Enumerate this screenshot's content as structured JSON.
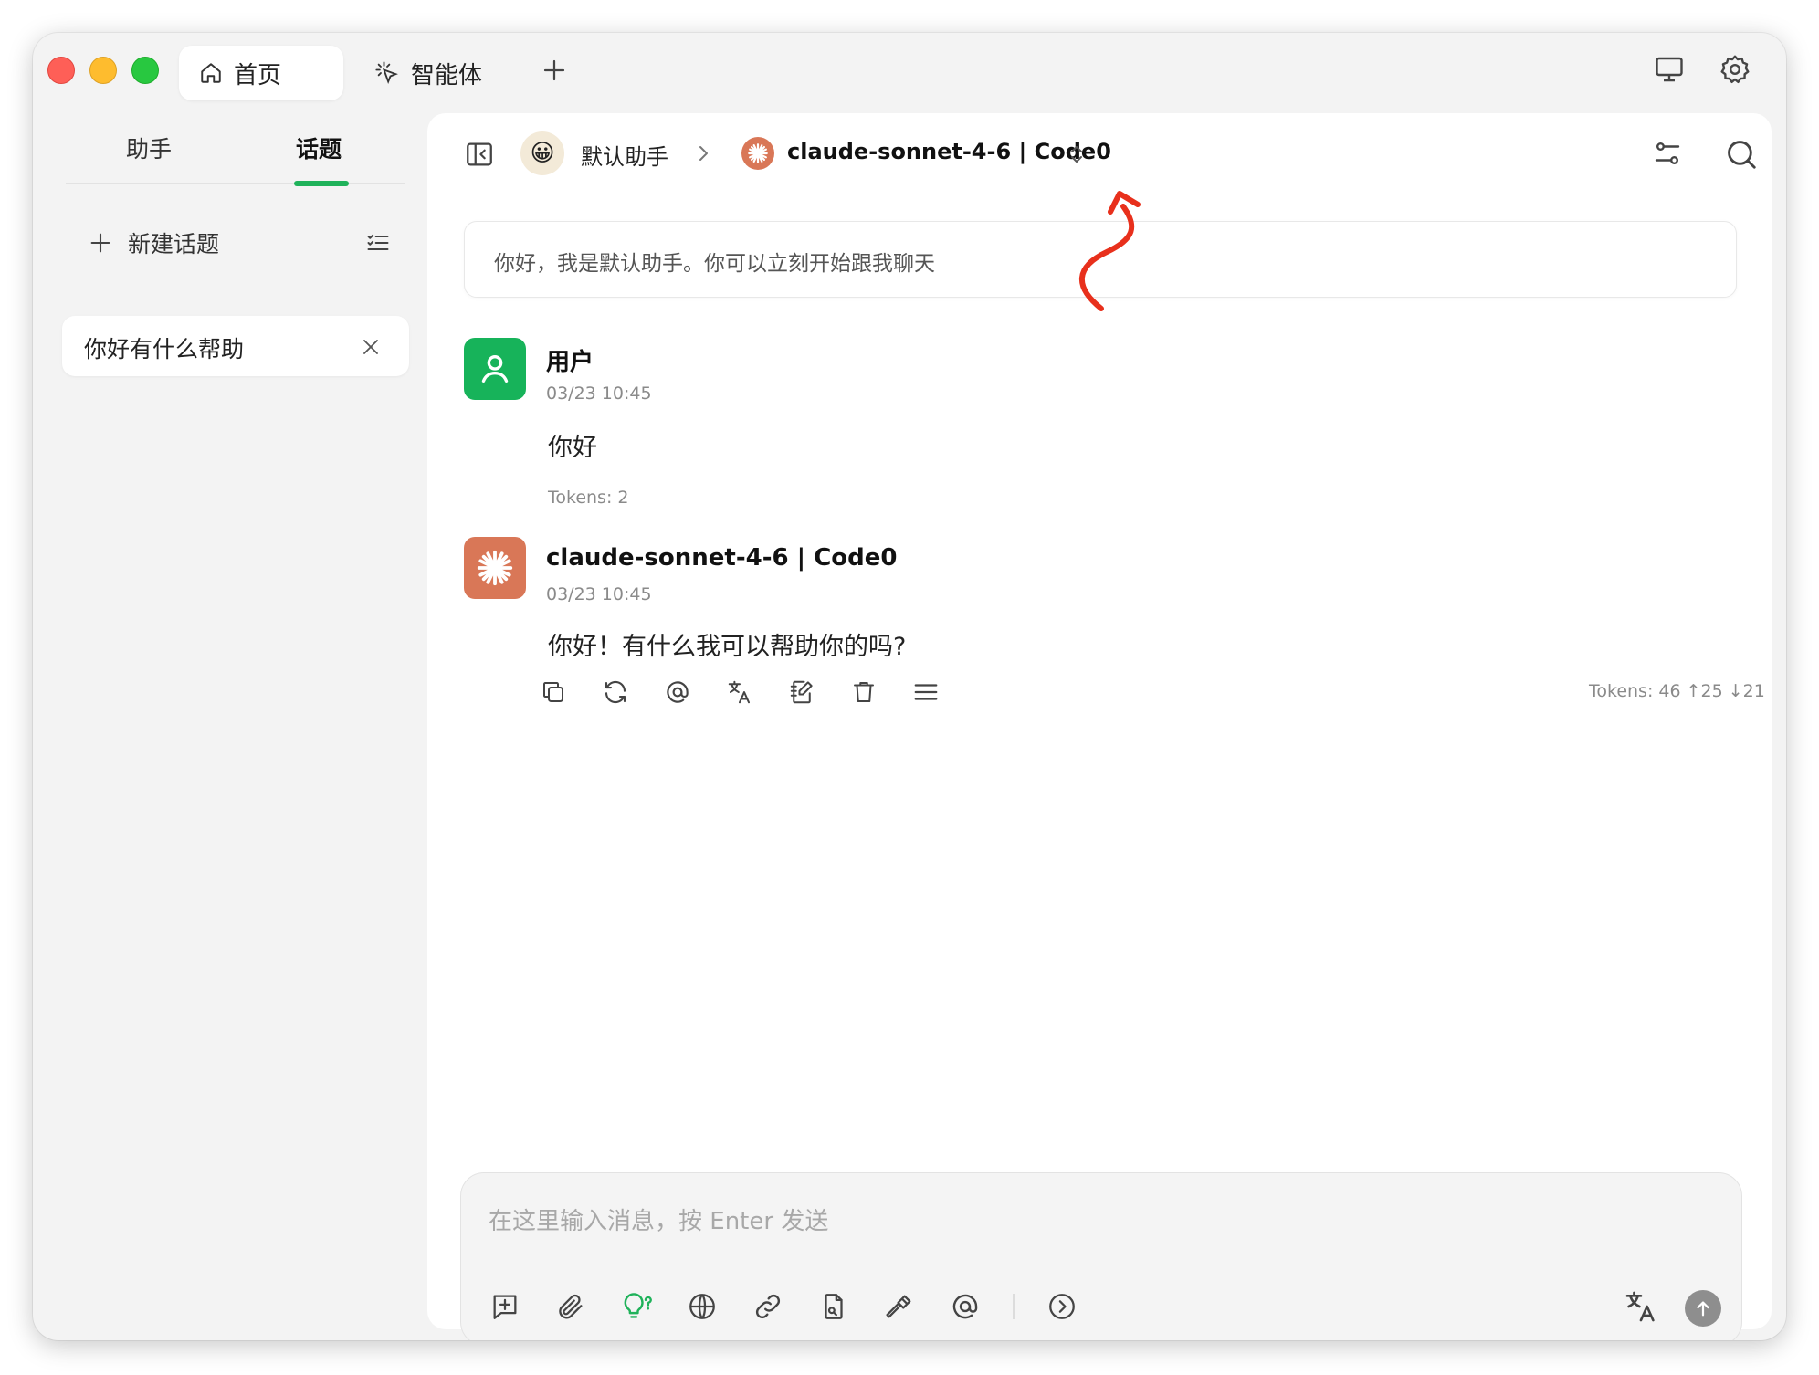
{
  "window": {
    "tabs": [
      {
        "label": "首页",
        "icon": "home-icon",
        "active": true
      },
      {
        "label": "智能体",
        "icon": "sparkle-cursor-icon",
        "active": false
      }
    ],
    "new_tab_icon": "plus-icon",
    "right_icons": [
      "monitor-icon",
      "gear-icon"
    ]
  },
  "sidebar": {
    "tabs": [
      {
        "label": "助手",
        "active": false
      },
      {
        "label": "话题",
        "active": true
      }
    ],
    "new_topic_label": "新建话题",
    "topics": [
      {
        "label": "你好有什么帮助"
      }
    ]
  },
  "header": {
    "assistant_emoji": "😀",
    "assistant_name": "默认助手",
    "model_name": "claude-sonnet-4-6 | Code0"
  },
  "welcome_text": "你好，我是默认助手。你可以立刻开始跟我聊天",
  "messages": [
    {
      "role": "user",
      "name": "用户",
      "time": "03/23 10:45",
      "text": "你好",
      "tokens": "Tokens: 2"
    },
    {
      "role": "assistant",
      "name": "claude-sonnet-4-6 | Code0",
      "time": "03/23 10:45",
      "text": "你好！有什么我可以帮助你的吗?",
      "tokens": "Tokens: 46 ↑25 ↓21"
    }
  ],
  "message_actions": [
    "copy-icon",
    "regenerate-icon",
    "mention-icon",
    "translate-icon",
    "edit-notebook-icon",
    "trash-icon",
    "menu-icon"
  ],
  "composer": {
    "placeholder": "在这里输入消息，按 Enter 发送",
    "tools": [
      "new-topic-icon",
      "attachment-icon",
      "thinking-bulb-icon",
      "web-search-icon",
      "link-icon",
      "quick-phrase-icon",
      "tools-hammer-icon",
      "mention-icon",
      "expand-icon"
    ]
  },
  "colors": {
    "accent_green": "#1fb25a",
    "claude_orange": "#d97757",
    "annotation_red": "#e8301c"
  }
}
